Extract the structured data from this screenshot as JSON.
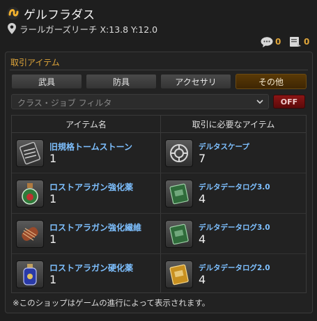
{
  "header": {
    "title": "ゲルフラダス",
    "location": "ラールガーズリーチ X:13.8 Y:12.0",
    "chat_count": "0",
    "quest_count": "0"
  },
  "panel": {
    "title": "取引アイテム",
    "tabs": [
      {
        "label": "武具",
        "active": false
      },
      {
        "label": "防具",
        "active": false
      },
      {
        "label": "アクセサリ",
        "active": false
      },
      {
        "label": "その他",
        "active": true
      }
    ],
    "filter_placeholder": "クラス・ジョブ フィルタ",
    "filter_toggle": "OFF",
    "columns": [
      "アイテム名",
      "取引に必要なアイテム"
    ],
    "rows": [
      {
        "item": "旧規格トームストーン",
        "qty": "1",
        "req_item": "デルタスケープ",
        "req_qty": "7",
        "icon": "tomestone-icon",
        "req_icon": "deltascape-icon"
      },
      {
        "item": "ロストアラガン強化薬",
        "qty": "1",
        "req_item": "デルタデータログ3.0",
        "req_qty": "4",
        "icon": "potion-icon",
        "req_icon": "green-book-icon"
      },
      {
        "item": "ロストアラガン強化繊維",
        "qty": "1",
        "req_item": "デルタデータログ3.0",
        "req_qty": "4",
        "icon": "fiber-icon",
        "req_icon": "green-book-icon"
      },
      {
        "item": "ロストアラガン硬化薬",
        "qty": "1",
        "req_item": "デルタデータログ2.0",
        "req_qty": "4",
        "icon": "blue-potion-icon",
        "req_icon": "gold-book-icon"
      }
    ],
    "note": "※このショップはゲームの進行によって表示されます。"
  },
  "colors": {
    "accent": "#e0a63a",
    "link": "#7ec0ff",
    "active_tab": "#5a3a06",
    "off_button": "#8b1515"
  }
}
